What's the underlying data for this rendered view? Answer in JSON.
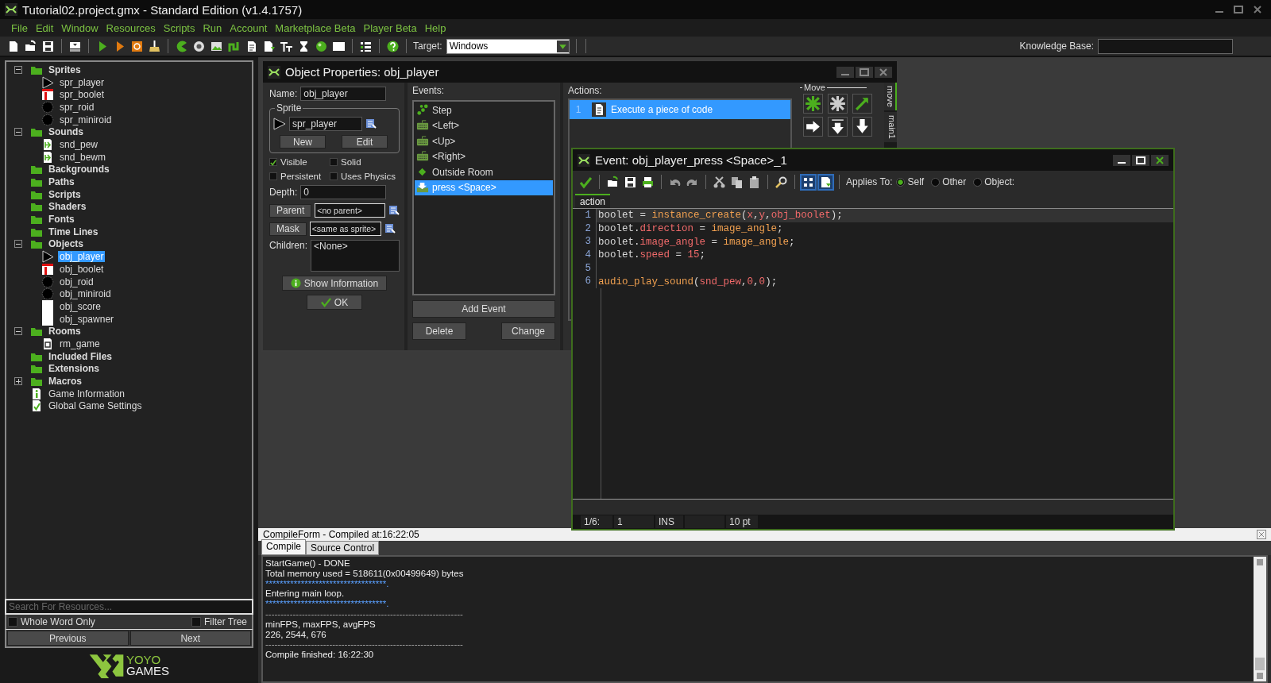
{
  "window": {
    "title": "Tutorial02.project.gmx  -  Standard Edition (v1.4.1757)"
  },
  "menu": [
    "File",
    "Edit",
    "Window",
    "Resources",
    "Scripts",
    "Run",
    "Account",
    "Marketplace Beta",
    "Player Beta",
    "Help"
  ],
  "toolbar": {
    "target_label": "Target:",
    "target_value": "Windows",
    "knowledge_base_label": "Knowledge Base:"
  },
  "resource_tree": [
    {
      "label": "Sprites",
      "kind": "folder",
      "expanded": true,
      "selected": false,
      "children": [
        {
          "label": "spr_player",
          "kind": "ship",
          "selected": false
        },
        {
          "label": "spr_boolet",
          "kind": "bullet",
          "selected": false
        },
        {
          "label": "spr_roid",
          "kind": "rock",
          "selected": false
        },
        {
          "label": "spr_miniroid",
          "kind": "rock",
          "selected": false
        }
      ]
    },
    {
      "label": "Sounds",
      "kind": "folder",
      "expanded": true,
      "selected": false,
      "children": [
        {
          "label": "snd_pew",
          "kind": "sound",
          "selected": false
        },
        {
          "label": "snd_bewm",
          "kind": "sound",
          "selected": false
        }
      ]
    },
    {
      "label": "Backgrounds",
      "kind": "folder",
      "selected": false
    },
    {
      "label": "Paths",
      "kind": "folder",
      "selected": false
    },
    {
      "label": "Scripts",
      "kind": "folder",
      "selected": false
    },
    {
      "label": "Shaders",
      "kind": "folder",
      "selected": false
    },
    {
      "label": "Fonts",
      "kind": "folder",
      "selected": false
    },
    {
      "label": "Time Lines",
      "kind": "folder",
      "selected": false
    },
    {
      "label": "Objects",
      "kind": "folder",
      "expanded": true,
      "selected": false,
      "children": [
        {
          "label": "obj_player",
          "kind": "ship",
          "selected": true
        },
        {
          "label": "obj_boolet",
          "kind": "bullet",
          "selected": false
        },
        {
          "label": "obj_roid",
          "kind": "rock",
          "selected": false
        },
        {
          "label": "obj_miniroid",
          "kind": "rock",
          "selected": false
        },
        {
          "label": "obj_score",
          "kind": "blank",
          "selected": false
        },
        {
          "label": "obj_spawner",
          "kind": "blank",
          "selected": false
        }
      ]
    },
    {
      "label": "Rooms",
      "kind": "folder",
      "expanded": true,
      "selected": false,
      "children": [
        {
          "label": "rm_game",
          "kind": "room",
          "selected": false
        }
      ]
    },
    {
      "label": "Included Files",
      "kind": "folder",
      "selected": false
    },
    {
      "label": "Extensions",
      "kind": "folder",
      "selected": false
    },
    {
      "label": "Macros",
      "kind": "folder",
      "expanded": false,
      "selected": false
    },
    {
      "label": "Game Information",
      "kind": "info",
      "selected": false
    },
    {
      "label": "Global Game Settings",
      "kind": "settings",
      "selected": false
    }
  ],
  "resource_search": {
    "placeholder": "Search For Resources...",
    "options": [
      {
        "label": "Whole Word Only",
        "checked": false
      },
      {
        "label": "Filter Tree",
        "checked": false
      }
    ],
    "buttons": [
      "Previous",
      "Next"
    ]
  },
  "logo": {
    "line_1": "YOYO",
    "line_2": "GAMES"
  },
  "object_properties": {
    "title": "Object Properties: obj_player",
    "name_label": "Name:",
    "name_value": "obj_player",
    "sprite_group": "Sprite",
    "sprite_value": "spr_player",
    "sprite_buttons": [
      "New",
      "Edit"
    ],
    "checkboxes": [
      {
        "label": "Visible",
        "checked": true
      },
      {
        "label": "Solid",
        "checked": false
      },
      {
        "label": "Persistent",
        "checked": false
      },
      {
        "label": "Uses Physics",
        "checked": false
      }
    ],
    "depth_label": "Depth:",
    "depth_value": "0",
    "parent_button": "Parent",
    "parent_value": "<no parent>",
    "mask_button": "Mask",
    "mask_value": "<same as sprite>",
    "children_label": "Children:",
    "children_value": "<None>",
    "show_information": "Show Information",
    "ok": "OK",
    "events_label": "Events:",
    "events": [
      {
        "label": "Step",
        "kind": "step",
        "selected": false
      },
      {
        "label": "<Left>",
        "kind": "keyboard",
        "selected": false
      },
      {
        "label": "<Up>",
        "kind": "keyboard",
        "selected": false
      },
      {
        "label": "<Right>",
        "kind": "keyboard",
        "selected": false
      },
      {
        "label": "Outside Room",
        "kind": "other",
        "selected": false
      },
      {
        "label": "press <Space>",
        "kind": "press",
        "selected": true
      }
    ],
    "event_buttons": [
      "Add Event",
      "Delete",
      "Change"
    ],
    "actions_label": "Actions:",
    "actions": [
      {
        "number": "1",
        "label": "Execute a piece of code",
        "selected": true
      }
    ],
    "library_group": "Move",
    "library_tabs": [
      {
        "label": "move",
        "selected": true
      },
      {
        "label": "main1",
        "selected": false
      }
    ]
  },
  "event_editor": {
    "title": "Event: obj_player_press <Space>_1",
    "applies_label": "Applies To:",
    "applies": [
      {
        "label": "Self",
        "selected": true
      },
      {
        "label": "Other",
        "selected": false
      },
      {
        "label": "Object:",
        "selected": false
      }
    ],
    "tab": "action",
    "lines": [
      {
        "number": "1",
        "current": true,
        "tokens": [
          {
            "text": "boolet = ",
            "kind": "plain"
          },
          {
            "text": "instance_create",
            "kind": "function"
          },
          {
            "text": "(",
            "kind": "plain"
          },
          {
            "text": "x",
            "kind": "resource"
          },
          {
            "text": ",",
            "kind": "plain"
          },
          {
            "text": "y",
            "kind": "resource"
          },
          {
            "text": ",",
            "kind": "plain"
          },
          {
            "text": "obj_boolet",
            "kind": "resource"
          },
          {
            "text": ");",
            "kind": "plain"
          }
        ]
      },
      {
        "number": "2",
        "current": false,
        "tokens": [
          {
            "text": "boolet.",
            "kind": "plain"
          },
          {
            "text": "direction",
            "kind": "resource"
          },
          {
            "text": " = ",
            "kind": "plain"
          },
          {
            "text": "image_angle",
            "kind": "function"
          },
          {
            "text": ";",
            "kind": "plain"
          }
        ]
      },
      {
        "number": "3",
        "current": false,
        "tokens": [
          {
            "text": "boolet.",
            "kind": "plain"
          },
          {
            "text": "image_angle",
            "kind": "resource"
          },
          {
            "text": " = ",
            "kind": "plain"
          },
          {
            "text": "image_angle",
            "kind": "function"
          },
          {
            "text": ";",
            "kind": "plain"
          }
        ]
      },
      {
        "number": "4",
        "current": false,
        "tokens": [
          {
            "text": "boolet.",
            "kind": "plain"
          },
          {
            "text": "speed",
            "kind": "resource"
          },
          {
            "text": " = ",
            "kind": "plain"
          },
          {
            "text": "15",
            "kind": "resource"
          },
          {
            "text": ";",
            "kind": "plain"
          }
        ]
      },
      {
        "number": "5",
        "current": false
      },
      {
        "number": "6",
        "current": false,
        "tokens": [
          {
            "text": "audio_play_sound",
            "kind": "function"
          },
          {
            "text": "(",
            "kind": "plain"
          },
          {
            "text": "snd_pew",
            "kind": "resource"
          },
          {
            "text": ",",
            "kind": "plain"
          },
          {
            "text": "0",
            "kind": "resource"
          },
          {
            "text": ",",
            "kind": "plain"
          },
          {
            "text": "0",
            "kind": "resource"
          },
          {
            "text": ");",
            "kind": "plain"
          }
        ]
      }
    ],
    "status": {
      "position": "1/6:",
      "column": "1",
      "mode": "INS",
      "font_size": "10 pt"
    }
  },
  "compile_form": {
    "title": "CompileForm - Compiled at:16:22:05",
    "tabs": [
      {
        "label": "Compile",
        "selected": true
      },
      {
        "label": "Source Control",
        "selected": false
      }
    ],
    "output": [
      {
        "text": "StartGame() - DONE",
        "kind": "text"
      },
      {
        "text": "Total memory used = 518611(0x00499649) bytes",
        "kind": "text"
      },
      {
        "text": "**********************************.",
        "kind": "highlight"
      },
      {
        "text": "Entering main loop.",
        "kind": "text"
      },
      {
        "text": "**********************************.",
        "kind": "highlight"
      },
      {
        "text": "-----------------------------------------------------------------",
        "kind": "rule"
      },
      {
        "text": "minFPS, maxFPS, avgFPS",
        "kind": "text"
      },
      {
        "text": "226, 2544, 676",
        "kind": "text"
      },
      {
        "text": "-----------------------------------------------------------------",
        "kind": "rule"
      },
      {
        "text": "Compile finished: 16:22:30",
        "kind": "text"
      }
    ]
  }
}
